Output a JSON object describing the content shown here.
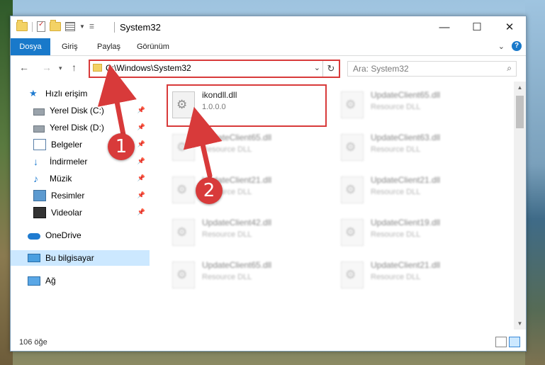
{
  "window": {
    "title": "System32",
    "controls": [
      "—",
      "☐",
      "✕"
    ]
  },
  "ribbon": {
    "tabs": [
      "Dosya",
      "Giriş",
      "Paylaş",
      "Görünüm"
    ],
    "help": "?"
  },
  "address": {
    "path": "C:\\Windows\\System32"
  },
  "search": {
    "placeholder": "Ara: System32"
  },
  "sidebar": {
    "items": [
      {
        "label": "Hızlı erişim"
      },
      {
        "label": "Yerel Disk (C:)"
      },
      {
        "label": "Yerel Disk (D:)"
      },
      {
        "label": "Belgeler"
      },
      {
        "label": "İndirmeler"
      },
      {
        "label": "Müzik"
      },
      {
        "label": "Resimler"
      },
      {
        "label": "Videolar"
      },
      {
        "label": "OneDrive"
      },
      {
        "label": "Bu bilgisayar"
      },
      {
        "label": "Ağ"
      }
    ]
  },
  "files": [
    {
      "name": "ikondll.dll",
      "sub": "1.0.0.0",
      "blurred": false
    },
    {
      "name": "UpdateClient65.dll",
      "sub": "Resource DLL",
      "blurred": true
    },
    {
      "name": "UpdateClient65.dll",
      "sub": "Resource DLL",
      "blurred": true
    },
    {
      "name": "UpdateClient63.dll",
      "sub": "Resource DLL",
      "blurred": true
    },
    {
      "name": "UpdateClient21.dll",
      "sub": "Resource DLL",
      "blurred": true
    },
    {
      "name": "UpdateClient21.dll",
      "sub": "Resource DLL",
      "blurred": true
    },
    {
      "name": "UpdateClient42.dll",
      "sub": "Resource DLL",
      "blurred": true
    },
    {
      "name": "UpdateClient19.dll",
      "sub": "Resource DLL",
      "blurred": true
    },
    {
      "name": "UpdateClient65.dll",
      "sub": "Resource DLL",
      "blurred": true
    },
    {
      "name": "UpdateClient21.dll",
      "sub": "Resource DLL",
      "blurred": true
    }
  ],
  "status": {
    "count": "106 öğe"
  },
  "callouts": [
    "1",
    "2"
  ],
  "colors": {
    "accent": "#1979ca",
    "highlight": "#d83a3a"
  }
}
